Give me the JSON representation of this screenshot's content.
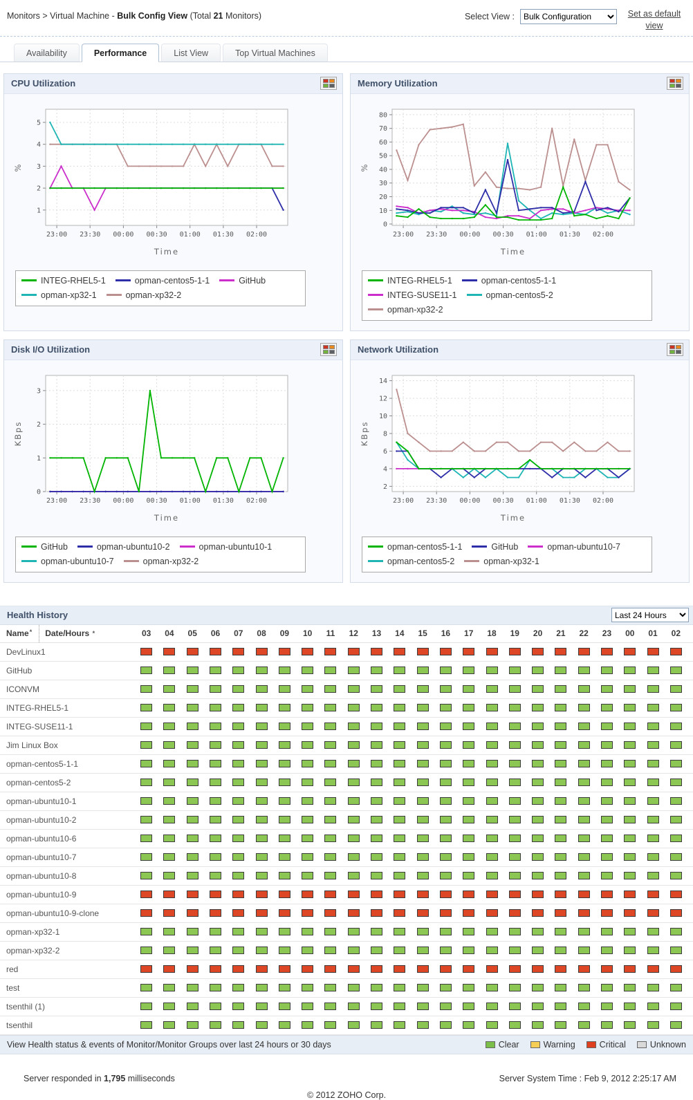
{
  "header": {
    "breadcrumb_path": "Monitors > Virtual Machine - ",
    "breadcrumb_view": "Bulk Config View",
    "total_prefix": " (Total ",
    "total_count": "21",
    "total_suffix": " Monitors)",
    "select_view_label": "Select View :",
    "select_view_value": "Bulk Configuration",
    "set_default_link": "Set as default view"
  },
  "tabs": [
    {
      "label": "Availability",
      "active": false
    },
    {
      "label": "Performance",
      "active": true
    },
    {
      "label": "List View",
      "active": false
    },
    {
      "label": "Top Virtual Machines",
      "active": false
    }
  ],
  "chart_data": [
    {
      "type": "line",
      "title": "CPU Utilization",
      "xlabel": "Time",
      "ylabel": "%",
      "ylim": [
        0.3,
        5.6
      ],
      "yticks": [
        1,
        2,
        3,
        4,
        5
      ],
      "xlim": [
        -10,
        208
      ],
      "x_start_min": -6,
      "x_step_min": 10,
      "xtick_pos": [
        0,
        30,
        60,
        90,
        120,
        150,
        180
      ],
      "xtick_labels": [
        "23:00",
        "23:30",
        "00:00",
        "00:30",
        "01:00",
        "01:30",
        "02:00"
      ],
      "grid": true,
      "legend_position": "bottom",
      "series": [
        {
          "name": "INTEG-RHEL5-1",
          "color": "#00b400",
          "values": [
            2,
            2,
            2,
            2,
            2,
            2,
            2,
            2,
            2,
            2,
            2,
            2,
            2,
            2,
            2,
            2,
            2,
            2,
            2,
            2,
            2,
            2
          ]
        },
        {
          "name": "opman-centos5-1-1",
          "color": "#2e2ea8",
          "values": [
            2,
            2,
            2,
            2,
            2,
            2,
            2,
            2,
            2,
            2,
            2,
            2,
            2,
            2,
            2,
            2,
            2,
            2,
            2,
            2,
            2,
            1
          ]
        },
        {
          "name": "GitHub",
          "color": "#cc2ecc",
          "values": [
            2,
            3,
            2,
            2,
            1,
            2,
            2,
            2,
            2,
            2,
            2,
            2,
            2,
            2,
            2,
            2,
            2,
            2,
            2,
            2,
            2,
            2
          ]
        },
        {
          "name": "opman-xp32-1",
          "color": "#1fb5b5",
          "values": [
            5,
            4,
            4,
            4,
            4,
            4,
            4,
            4,
            4,
            4,
            4,
            4,
            4,
            4,
            4,
            4,
            4,
            4,
            4,
            4,
            4,
            4
          ]
        },
        {
          "name": "opman-xp32-2",
          "color": "#bc8f8f",
          "values": [
            4,
            4,
            4,
            4,
            4,
            4,
            4,
            3,
            3,
            3,
            3,
            3,
            3,
            4,
            3,
            4,
            3,
            4,
            4,
            4,
            3,
            3
          ]
        }
      ]
    },
    {
      "type": "line",
      "title": "Memory Utilization",
      "xlabel": "Time",
      "ylabel": "%",
      "ylim": [
        -1,
        84
      ],
      "yticks": [
        0,
        10,
        20,
        30,
        40,
        50,
        60,
        70,
        80
      ],
      "xlim": [
        -10,
        208
      ],
      "x_start_min": -6,
      "x_step_min": 10,
      "xtick_pos": [
        0,
        30,
        60,
        90,
        120,
        150,
        180
      ],
      "xtick_labels": [
        "23:00",
        "23:30",
        "00:00",
        "00:30",
        "01:00",
        "01:30",
        "02:00"
      ],
      "grid": true,
      "legend_position": "bottom",
      "series": [
        {
          "name": "INTEG-RHEL5-1",
          "color": "#00b400",
          "values": [
            6,
            5,
            11,
            5,
            4,
            4,
            4,
            5,
            14,
            5,
            5,
            3,
            3,
            3,
            4,
            27,
            6,
            7,
            4,
            6,
            4,
            19
          ]
        },
        {
          "name": "opman-centos5-1-1",
          "color": "#2e2ea8",
          "values": [
            11,
            10,
            8,
            8,
            12,
            12,
            12,
            8,
            25,
            8,
            47,
            10,
            11,
            12,
            12,
            8,
            9,
            31,
            10,
            12,
            9,
            19
          ]
        },
        {
          "name": "INTEG-SUSE11-1",
          "color": "#cc2ecc",
          "values": [
            13,
            12,
            8,
            10,
            11,
            10,
            10,
            9,
            5,
            4,
            6,
            6,
            4,
            10,
            11,
            11,
            8,
            10,
            12,
            11,
            10,
            10
          ]
        },
        {
          "name": "opman-centos5-2",
          "color": "#1fb5b5",
          "values": [
            8,
            9,
            7,
            10,
            9,
            13,
            8,
            7,
            8,
            6,
            59,
            17,
            10,
            4,
            8,
            7,
            8,
            7,
            12,
            8,
            10,
            7
          ]
        },
        {
          "name": "opman-xp32-2",
          "color": "#bc8f8f",
          "values": [
            54,
            32,
            58,
            69,
            70,
            71,
            73,
            28,
            38,
            27,
            26,
            26,
            25,
            27,
            70,
            28,
            62,
            32,
            58,
            58,
            31,
            25
          ]
        }
      ]
    },
    {
      "type": "line",
      "title": "Disk I/O Utilization",
      "xlabel": "Time",
      "ylabel": "KBps",
      "ylim": [
        0,
        3.45
      ],
      "yticks": [
        0,
        1,
        2,
        3
      ],
      "xlim": [
        -10,
        208
      ],
      "x_start_min": -6,
      "x_step_min": 10,
      "xtick_pos": [
        0,
        30,
        60,
        90,
        120,
        150,
        180
      ],
      "xtick_labels": [
        "23:00",
        "23:30",
        "00:00",
        "00:30",
        "01:00",
        "01:30",
        "02:00"
      ],
      "grid": true,
      "legend_position": "bottom",
      "series": [
        {
          "name": "GitHub",
          "color": "#00b400",
          "values": [
            1,
            1,
            1,
            1,
            0,
            1,
            1,
            1,
            0,
            3,
            1,
            1,
            1,
            1,
            0,
            1,
            1,
            0,
            1,
            1,
            0,
            1
          ]
        },
        {
          "name": "opman-ubuntu10-2",
          "color": "#2e2ea8",
          "values": [
            0,
            0,
            0,
            0,
            0,
            0,
            0,
            0,
            0,
            0,
            0,
            0,
            0,
            0,
            0,
            0,
            0,
            0,
            0,
            0,
            0,
            0
          ]
        },
        {
          "name": "opman-ubuntu10-1",
          "color": "#cc2ecc",
          "values": [
            0,
            0,
            0,
            0,
            0,
            0,
            0,
            0,
            0,
            0,
            0,
            0,
            0,
            0,
            0,
            0,
            0,
            0,
            0,
            0,
            0,
            0
          ]
        },
        {
          "name": "opman-ubuntu10-7",
          "color": "#1fb5b5",
          "values": [
            0,
            0,
            0,
            0,
            0,
            0,
            0,
            0,
            0,
            0,
            0,
            0,
            0,
            0,
            0,
            0,
            0,
            0,
            0,
            0,
            0,
            0
          ]
        },
        {
          "name": "opman-xp32-2",
          "color": "#bc8f8f",
          "values": [
            0,
            0,
            0,
            0,
            0,
            0,
            0,
            0,
            0,
            0,
            0,
            0,
            0,
            0,
            0,
            0,
            0,
            0,
            0,
            0,
            0,
            0
          ]
        }
      ]
    },
    {
      "type": "line",
      "title": "Network Utilization",
      "xlabel": "Time",
      "ylabel": "KBps",
      "ylim": [
        1.4,
        14.6
      ],
      "yticks": [
        2,
        4,
        6,
        8,
        10,
        12,
        14
      ],
      "xlim": [
        -10,
        208
      ],
      "x_start_min": -6,
      "x_step_min": 10,
      "xtick_pos": [
        0,
        30,
        60,
        90,
        120,
        150,
        180
      ],
      "xtick_labels": [
        "23:00",
        "23:30",
        "00:00",
        "00:30",
        "01:00",
        "01:30",
        "02:00"
      ],
      "grid": true,
      "legend_position": "bottom",
      "series": [
        {
          "name": "opman-centos5-1-1",
          "color": "#00b400",
          "values": [
            7,
            6,
            4,
            4,
            4,
            4,
            4,
            4,
            4,
            4,
            4,
            4,
            5,
            4,
            4,
            4,
            4,
            4,
            4,
            4,
            4,
            4
          ]
        },
        {
          "name": "GitHub",
          "color": "#2e2ea8",
          "values": [
            6,
            6,
            4,
            4,
            3,
            4,
            4,
            3,
            4,
            4,
            4,
            4,
            4,
            4,
            3,
            4,
            4,
            3,
            4,
            4,
            3,
            4
          ]
        },
        {
          "name": "opman-ubuntu10-7",
          "color": "#cc2ecc",
          "values": [
            4,
            4,
            4,
            4,
            4,
            4,
            4,
            4,
            4,
            4,
            4,
            4,
            4,
            4,
            4,
            4,
            4,
            4,
            4,
            4,
            4,
            4
          ]
        },
        {
          "name": "opman-centos5-2",
          "color": "#1fb5b5",
          "values": [
            7,
            5,
            4,
            4,
            4,
            4,
            3,
            4,
            3,
            4,
            3,
            3,
            5,
            4,
            4,
            3,
            3,
            4,
            4,
            3,
            3,
            4
          ]
        },
        {
          "name": "opman-xp32-1",
          "color": "#bc8f8f",
          "values": [
            13,
            8,
            7,
            6,
            6,
            6,
            7,
            6,
            6,
            7,
            7,
            6,
            6,
            7,
            7,
            6,
            7,
            6,
            6,
            7,
            6,
            6
          ]
        }
      ]
    }
  ],
  "health": {
    "title": "Health History",
    "range_value": "Last 24 Hours",
    "name_header": "Name",
    "date_hours_header": "Date/Hours",
    "sort_glyph": "*",
    "hours": [
      "03",
      "04",
      "05",
      "06",
      "07",
      "08",
      "09",
      "10",
      "11",
      "12",
      "13",
      "14",
      "15",
      "16",
      "17",
      "18",
      "19",
      "20",
      "21",
      "22",
      "23",
      "00",
      "01",
      "02"
    ],
    "status_colors": {
      "clear": "#8CC653",
      "warning": "#F6CE55",
      "critical": "#DD4726",
      "unknown": "#D9D9D9"
    },
    "rows": [
      {
        "name": "DevLinux1",
        "status": "critical"
      },
      {
        "name": "GitHub",
        "status": "clear"
      },
      {
        "name": "ICONVM",
        "status": "clear"
      },
      {
        "name": "INTEG-RHEL5-1",
        "status": "clear"
      },
      {
        "name": "INTEG-SUSE11-1",
        "status": "clear"
      },
      {
        "name": "Jim Linux Box",
        "status": "clear"
      },
      {
        "name": "opman-centos5-1-1",
        "status": "clear"
      },
      {
        "name": "opman-centos5-2",
        "status": "clear"
      },
      {
        "name": "opman-ubuntu10-1",
        "status": "clear"
      },
      {
        "name": "opman-ubuntu10-2",
        "status": "clear"
      },
      {
        "name": "opman-ubuntu10-6",
        "status": "clear"
      },
      {
        "name": "opman-ubuntu10-7",
        "status": "clear"
      },
      {
        "name": "opman-ubuntu10-8",
        "status": "clear"
      },
      {
        "name": "opman-ubuntu10-9",
        "status": "critical"
      },
      {
        "name": "opman-ubuntu10-9-clone",
        "status": "critical"
      },
      {
        "name": "opman-xp32-1",
        "status": "clear"
      },
      {
        "name": "opman-xp32-2",
        "status": "clear"
      },
      {
        "name": "red",
        "status": "critical"
      },
      {
        "name": "test",
        "status": "clear"
      },
      {
        "name": "tsenthil (1)",
        "status": "clear"
      },
      {
        "name": "tsenthil",
        "status": "clear"
      }
    ],
    "footer_text": "View Health status & events of Monitor/Monitor Groups over last 24 hours or 30 days",
    "legend": [
      {
        "label": "Clear",
        "color": "#7CBE4A"
      },
      {
        "label": "Warning",
        "color": "#F6CE55"
      },
      {
        "label": "Critical",
        "color": "#DD3F1F"
      },
      {
        "label": "Unknown",
        "color": "#D9D9D9"
      }
    ]
  },
  "footer": {
    "responded_prefix": "Server responded in ",
    "responded_value": "1,795",
    "responded_suffix": " milliseconds",
    "system_time": "Server System Time : Feb 9, 2012 2:25:17 AM",
    "copyright": "© 2012 ZOHO Corp."
  }
}
